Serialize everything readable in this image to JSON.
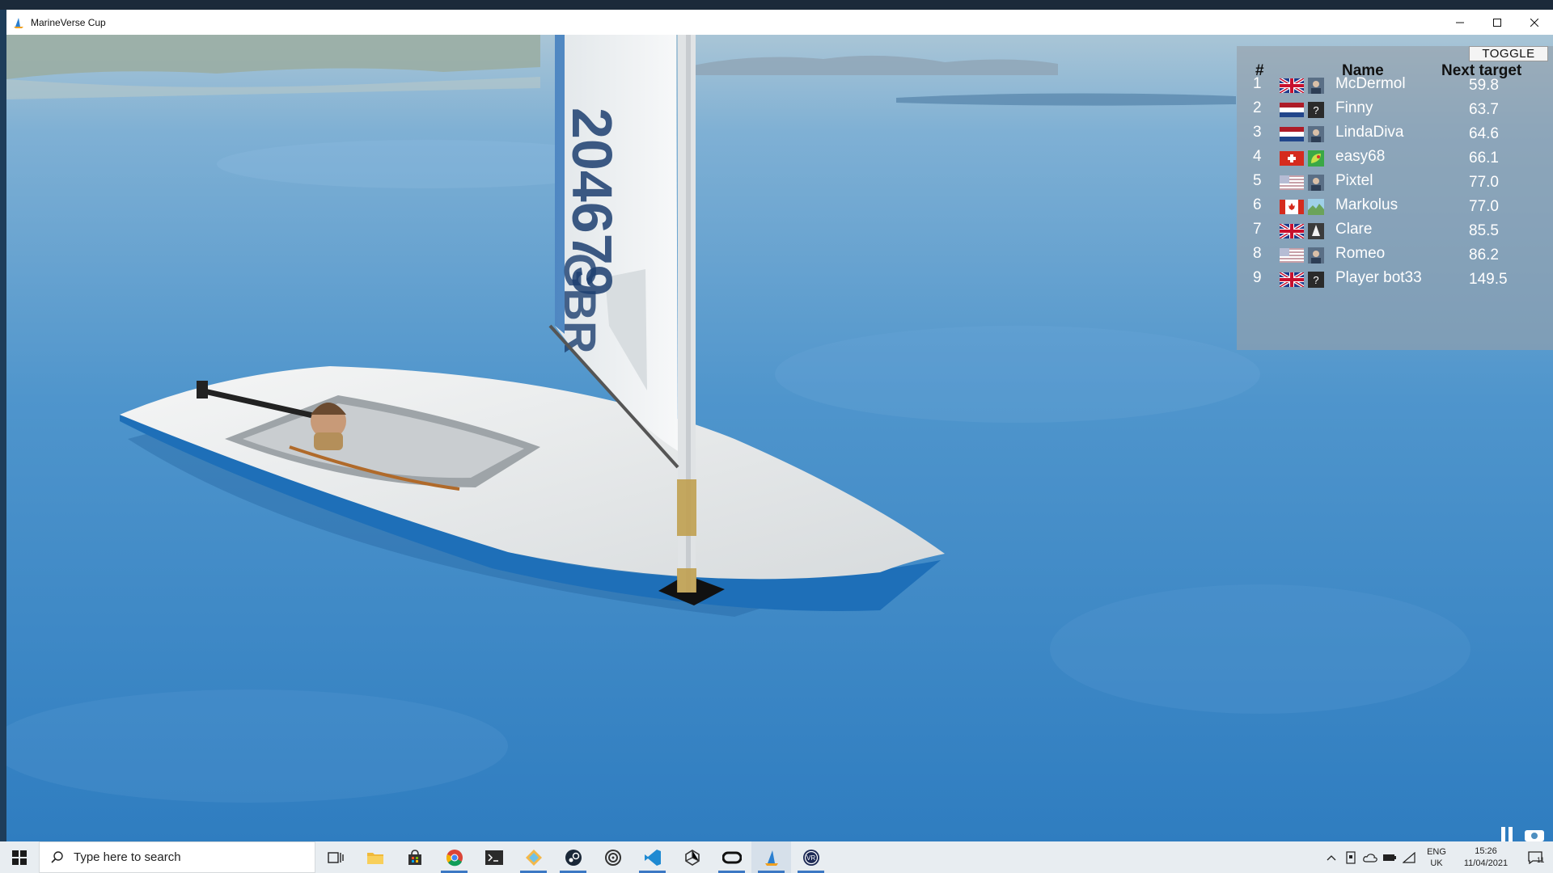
{
  "window": {
    "title": "MarineVerse Cup",
    "minimize_icon": "minimize-icon",
    "maximize_icon": "maximize-icon",
    "close_icon": "close-icon"
  },
  "scene": {
    "sail_number": "204679",
    "sail_country": "GBR"
  },
  "leaderboard": {
    "toggle_label": "TOGGLE",
    "col_rank": "#",
    "col_name": "Name",
    "col_next": "Next target",
    "rows": [
      {
        "rank": "1",
        "flag": "gb",
        "avatar": "photo",
        "name": "McDermol",
        "next": "59.8"
      },
      {
        "rank": "2",
        "flag": "nl",
        "avatar": "?",
        "name": "Finny",
        "next": "63.7"
      },
      {
        "rank": "3",
        "flag": "nl",
        "avatar": "photo",
        "name": "LindaDiva",
        "next": "64.6"
      },
      {
        "rank": "4",
        "flag": "ch",
        "avatar": "leaf",
        "name": "easy68",
        "next": "66.1"
      },
      {
        "rank": "5",
        "flag": "us",
        "avatar": "photo",
        "name": "Pixtel",
        "next": "77.0"
      },
      {
        "rank": "6",
        "flag": "ca",
        "avatar": "landscape",
        "name": "Markolus",
        "next": "77.0"
      },
      {
        "rank": "7",
        "flag": "gb",
        "avatar": "sail",
        "name": "Clare",
        "next": "85.5"
      },
      {
        "rank": "8",
        "flag": "us",
        "avatar": "photo",
        "name": "Romeo",
        "next": "86.2"
      },
      {
        "rank": "9",
        "flag": "gb",
        "avatar": "?",
        "name": "Player bot33",
        "next": "149.5"
      }
    ]
  },
  "taskbar": {
    "search_placeholder": "Type here to search",
    "apps": [
      "task-view",
      "file-explorer",
      "store",
      "chrome",
      "terminal",
      "sketch-app",
      "steam",
      "target-app",
      "vscode",
      "unity",
      "oculus",
      "marineverse",
      "viveport"
    ],
    "lang_top": "ENG",
    "lang_bottom": "UK",
    "time": "15:26",
    "date": "11/04/2021",
    "notification_count": "11"
  },
  "colors": {
    "water": "#3f87c2",
    "hull_white": "#eef0f0",
    "hull_blue": "#1e6fb8",
    "board_bg": "rgba(150,160,170,0.62)"
  }
}
